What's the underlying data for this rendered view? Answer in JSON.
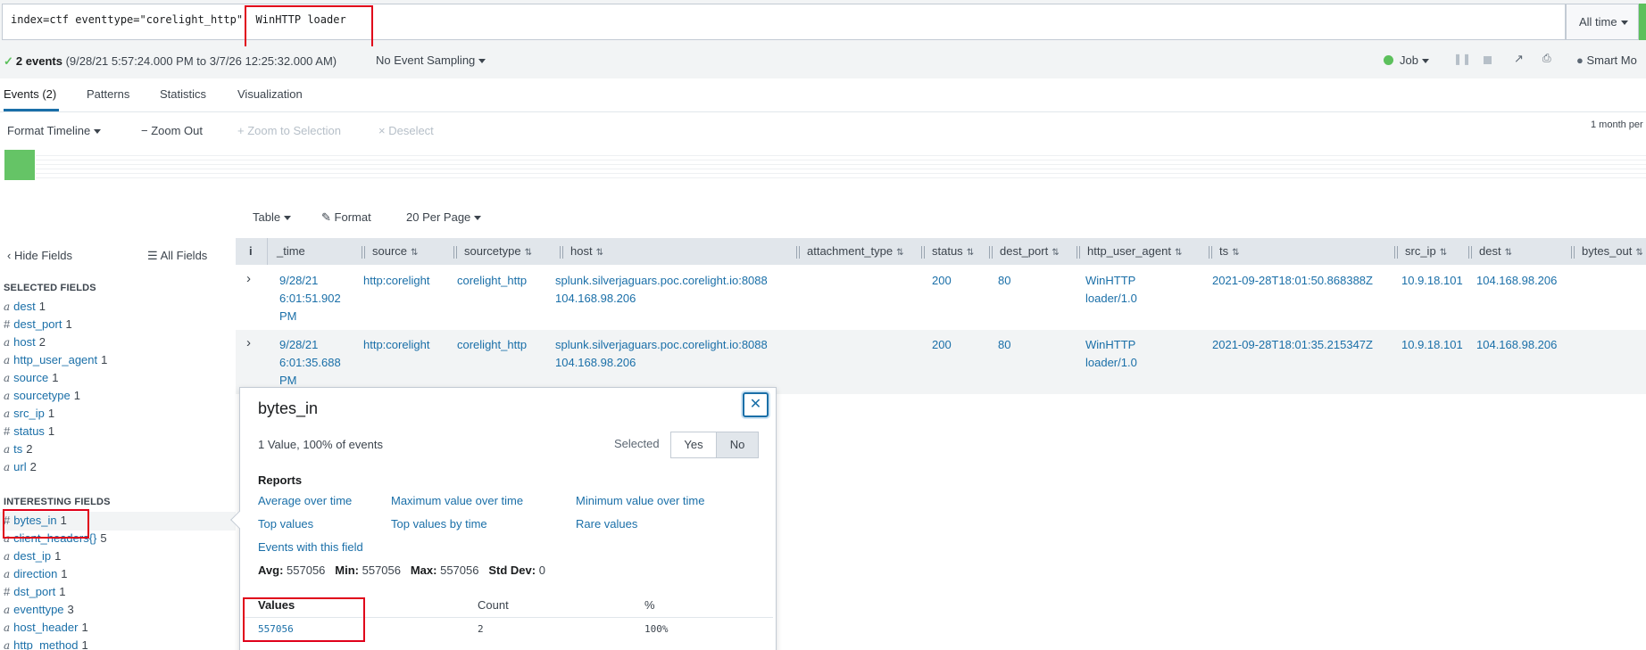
{
  "search": {
    "query": "index=ctf eventtype=\"corelight_http\"  WinHTTP loader",
    "time_range": "All time"
  },
  "status": {
    "count": "2 events",
    "range": "(9/28/21 5:57:24.000 PM to 3/7/26 12:25:32.000 AM)",
    "sampling": "No Event Sampling",
    "job": "Job",
    "mode": "Smart Mo"
  },
  "tabs": [
    "Events (2)",
    "Patterns",
    "Statistics",
    "Visualization"
  ],
  "timeline_toolbar": {
    "format": "Format Timeline",
    "zoom_out": "Zoom Out",
    "zoom_selection": "Zoom to Selection",
    "deselect": "Deselect",
    "scale": "1 month per"
  },
  "results_toolbar": {
    "view": "Table",
    "format": "Format",
    "per_page": "20 Per Page"
  },
  "sidebar": {
    "hide_fields": "Hide Fields",
    "all_fields": "All Fields",
    "selected_heading": "SELECTED FIELDS",
    "selected": [
      {
        "type": "a",
        "name": "dest",
        "count": "1"
      },
      {
        "type": "#",
        "name": "dest_port",
        "count": "1"
      },
      {
        "type": "a",
        "name": "host",
        "count": "2"
      },
      {
        "type": "a",
        "name": "http_user_agent",
        "count": "1"
      },
      {
        "type": "a",
        "name": "source",
        "count": "1"
      },
      {
        "type": "a",
        "name": "sourcetype",
        "count": "1"
      },
      {
        "type": "a",
        "name": "src_ip",
        "count": "1"
      },
      {
        "type": "#",
        "name": "status",
        "count": "1"
      },
      {
        "type": "a",
        "name": "ts",
        "count": "2"
      },
      {
        "type": "a",
        "name": "url",
        "count": "2"
      }
    ],
    "interesting_heading": "INTERESTING FIELDS",
    "interesting": [
      {
        "type": "#",
        "name": "bytes_in",
        "count": "1"
      },
      {
        "type": "a",
        "name": "client_headers{}",
        "count": "5"
      },
      {
        "type": "a",
        "name": "dest_ip",
        "count": "1"
      },
      {
        "type": "a",
        "name": "direction",
        "count": "1"
      },
      {
        "type": "#",
        "name": "dst_port",
        "count": "1"
      },
      {
        "type": "a",
        "name": "eventtype",
        "count": "3"
      },
      {
        "type": "a",
        "name": "host_header",
        "count": "1"
      },
      {
        "type": "a",
        "name": "http_method",
        "count": "1"
      }
    ]
  },
  "table": {
    "info_col": "i",
    "columns": [
      "_time",
      "source",
      "sourcetype",
      "host",
      "attachment_type",
      "status",
      "dest_port",
      "http_user_agent",
      "ts",
      "src_ip",
      "dest",
      "bytes_out"
    ],
    "rows": [
      {
        "time": [
          "9/28/21",
          "6:01:51.902",
          "PM"
        ],
        "source": "http:corelight",
        "sourcetype": "corelight_http",
        "host": [
          "splunk.silverjaguars.poc.corelight.io:8088",
          "104.168.98.206"
        ],
        "status": "200",
        "dest_port": "80",
        "http_user_agent": [
          "WinHTTP",
          "loader/1.0"
        ],
        "ts": "2021-09-28T18:01:50.868388Z",
        "src_ip": "10.9.18.101",
        "dest": "104.168.98.206"
      },
      {
        "time": [
          "9/28/21",
          "6:01:35.688",
          "PM"
        ],
        "source": "http:corelight",
        "sourcetype": "corelight_http",
        "host": [
          "splunk.silverjaguars.poc.corelight.io:8088",
          "104.168.98.206"
        ],
        "status": "200",
        "dest_port": "80",
        "http_user_agent": [
          "WinHTTP",
          "loader/1.0"
        ],
        "ts": "2021-09-28T18:01:35.215347Z",
        "src_ip": "10.9.18.101",
        "dest": "104.168.98.206"
      }
    ]
  },
  "popup": {
    "title": "bytes_in",
    "summary": "1 Value, 100% of events",
    "selected_label": "Selected",
    "yes": "Yes",
    "no": "No",
    "reports_heading": "Reports",
    "reports": [
      "Average over time",
      "Maximum value over time",
      "Minimum value over time",
      "Top values",
      "Top values by time",
      "Rare values",
      "Events with this field"
    ],
    "stats": {
      "avg_label": "Avg:",
      "avg": "557056",
      "min_label": "Min:",
      "min": "557056",
      "max_label": "Max:",
      "max": "557056",
      "std_label": "Std Dev:",
      "std": "0"
    },
    "values_header": [
      "Values",
      "Count",
      "%"
    ],
    "values": [
      {
        "value": "557056",
        "count": "2",
        "percent": "100%"
      }
    ]
  },
  "colors": {
    "link": "#1a6fa8",
    "highlight": "#e0001a",
    "timeline_bar": "#65c466"
  }
}
